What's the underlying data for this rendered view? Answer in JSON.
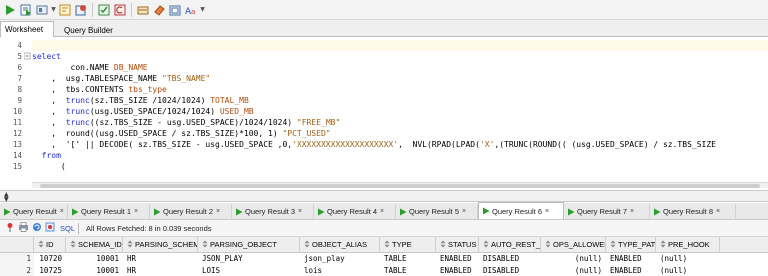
{
  "worksheet_tabs": [
    "Worksheet",
    "Query Builder"
  ],
  "line_numbers": [
    "4",
    "5",
    "6",
    "7",
    "8",
    "9",
    "10",
    "11",
    "12",
    "13",
    "14",
    "15"
  ],
  "code_lines": [
    [],
    [
      {
        "t": "select",
        "c": "kw"
      }
    ],
    [
      {
        "t": "        con.NAME ",
        "c": "plain"
      },
      {
        "t": "DB_NAME",
        "c": "alias"
      }
    ],
    [
      {
        "t": "    ,  usg.TABLESPACE_NAME ",
        "c": "plain"
      },
      {
        "t": "\"TBS_NAME\"",
        "c": "str"
      }
    ],
    [
      {
        "t": "    ,  tbs.CONTENTS ",
        "c": "plain"
      },
      {
        "t": "tbs_type",
        "c": "alias"
      }
    ],
    [
      {
        "t": "    ,  ",
        "c": "plain"
      },
      {
        "t": "trunc",
        "c": "kw"
      },
      {
        "t": "(sz.TBS_SIZE /1024/1024) ",
        "c": "plain"
      },
      {
        "t": "TOTAL_MB",
        "c": "alias"
      }
    ],
    [
      {
        "t": "    ,  ",
        "c": "plain"
      },
      {
        "t": "trunc",
        "c": "kw"
      },
      {
        "t": "(usg.USED_SPACE/1024/1024) ",
        "c": "plain"
      },
      {
        "t": "USED_MB",
        "c": "alias"
      }
    ],
    [
      {
        "t": "    ,  ",
        "c": "plain"
      },
      {
        "t": "trunc",
        "c": "kw"
      },
      {
        "t": "((sz.TBS_SIZE - usg.USED_SPACE)/1024/1024) ",
        "c": "plain"
      },
      {
        "t": "\"FREE_MB\"",
        "c": "str"
      }
    ],
    [
      {
        "t": "    ,  round((usg.USED_SPACE / sz.TBS_SIZE)*100, 1) ",
        "c": "plain"
      },
      {
        "t": "\"PCT_USED\"",
        "c": "str"
      }
    ],
    [
      {
        "t": "    ,  '[' || DECODE( sz.TBS_SIZE - usg.USED_SPACE ,0,",
        "c": "plain"
      },
      {
        "t": "'XXXXXXXXXXXXXXXXXXXX'",
        "c": "str"
      },
      {
        "t": ",  NVL(RPAD(LPAD(",
        "c": "plain"
      },
      {
        "t": "'X'",
        "c": "str"
      },
      {
        "t": ",(TRUNC(ROUND(( (usg.USED_SPACE) / sz.TBS_SIZE",
        "c": "plain"
      }
    ],
    [
      {
        "t": "  from",
        "c": "kw"
      }
    ],
    [
      {
        "t": "      (",
        "c": "plain"
      }
    ]
  ],
  "result_tabs": [
    "Query Result",
    "Query Result 1",
    "Query Result 2",
    "Query Result 3",
    "Query Result 4",
    "Query Result 5",
    "Query Result 6",
    "Query Result 7",
    "Query Result 8"
  ],
  "active_result_tab": 6,
  "results_toolbar": {
    "sql_label": "SQL",
    "status": "All Rows Fetched: 8 in 0.039 seconds"
  },
  "grid": {
    "columns": [
      "ID",
      "SCHEMA_ID",
      "PARSING_SCHEMA",
      "PARSING_OBJECT",
      "OBJECT_ALIAS",
      "TYPE",
      "STATUS",
      "AUTO_REST_AUTH",
      "OPS_ALLOWED",
      "TYPE_PATH",
      "PRE_HOOK"
    ],
    "rows": [
      {
        "n": "1",
        "cells": [
          "10720",
          "10001",
          "HR",
          "JSON_PLAY",
          "json_play",
          "TABLE",
          "ENABLED",
          "DISABLED",
          "(null)",
          "ENABLED",
          "(null)"
        ]
      },
      {
        "n": "2",
        "cells": [
          "10725",
          "10001",
          "HR",
          "LOIS",
          "lois",
          "TABLE",
          "ENABLED",
          "DISABLED",
          "(null)",
          "ENABLED",
          "(null)"
        ]
      }
    ]
  },
  "colors": {
    "keyword": "#1f2ad6",
    "string": "#a36014",
    "alias": "#b14a0d",
    "play": "#2e9b2e"
  }
}
